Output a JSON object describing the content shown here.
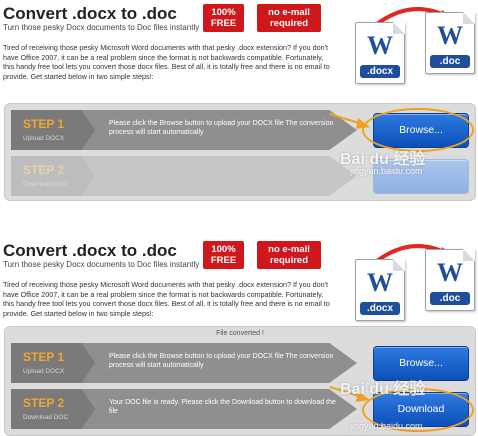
{
  "panels": [
    {
      "title": "Convert .docx to .doc",
      "subtitle": "Turn those pesky Docx documents to Doc files instantly",
      "badge_free": "100% FREE",
      "badge_email": "no e-mail required",
      "description": "Tired of receiving those pesky Microsoft Word documents with that pesky .docx extension? If you don't have Office 2007, it can be a real problem since the format is not backwards compatible. Fortunately, this handy free tool lets you convert those docx files. Best of all, it is totally free and there is no email to provide. Get started below in two simple steps!:",
      "doc_from": ".docx",
      "doc_to": ".doc",
      "doc_letter": "W",
      "status_note": "",
      "steps": [
        {
          "num": "STEP 1",
          "sub": "Upload DOCX",
          "text": "Please click the Browse button to upload your DOCX file The conversion process will start automatically",
          "button": "Browse..."
        },
        {
          "num": "STEP 2",
          "sub": "Download DOC",
          "text": "",
          "button": ""
        }
      ],
      "watermark": "Bai du 经验",
      "watermark_url": "jingyan.baidu.com"
    },
    {
      "title": "Convert .docx to .doc",
      "subtitle": "Turn those pesky Docx documents to Doc files instantly",
      "badge_free": "100% FREE",
      "badge_email": "no e-mail required",
      "description": "Tired of receiving those pesky Microsoft Word documents with that pesky .docx extension? If you don't have Office 2007, it can be a real problem since the format is not backwards compatible. Fortunately, this handy free tool lets you convert those docx files. Best of all, it is totally free and there is no email to provide. Get started below in two simple steps!:",
      "doc_from": ".docx",
      "doc_to": ".doc",
      "doc_letter": "W",
      "status_note": "File converted !",
      "steps": [
        {
          "num": "STEP 1",
          "sub": "Upload DOCX",
          "text": "Please click the Browse button to upload your DOCX file The conversion process will start automatically",
          "button": "Browse..."
        },
        {
          "num": "STEP 2",
          "sub": "Download DOC",
          "text": "Your DOC file is ready. Please click the Download button to download the file",
          "button": "Download"
        }
      ],
      "watermark": "Bai du 经验",
      "watermark_url": "jingyan.baidu.com"
    }
  ],
  "colors": {
    "badge_red": "#d0171c",
    "step_orange": "#f0a830",
    "button_blue": "#0b4fb8",
    "word_blue": "#1f4e9c",
    "highlight_orange": "#f0a023",
    "arrow_red": "#e0281e"
  },
  "icons": [
    "word-docx-icon",
    "word-doc-icon",
    "red-curved-arrow-icon",
    "orange-pointer-arrow-icon"
  ]
}
